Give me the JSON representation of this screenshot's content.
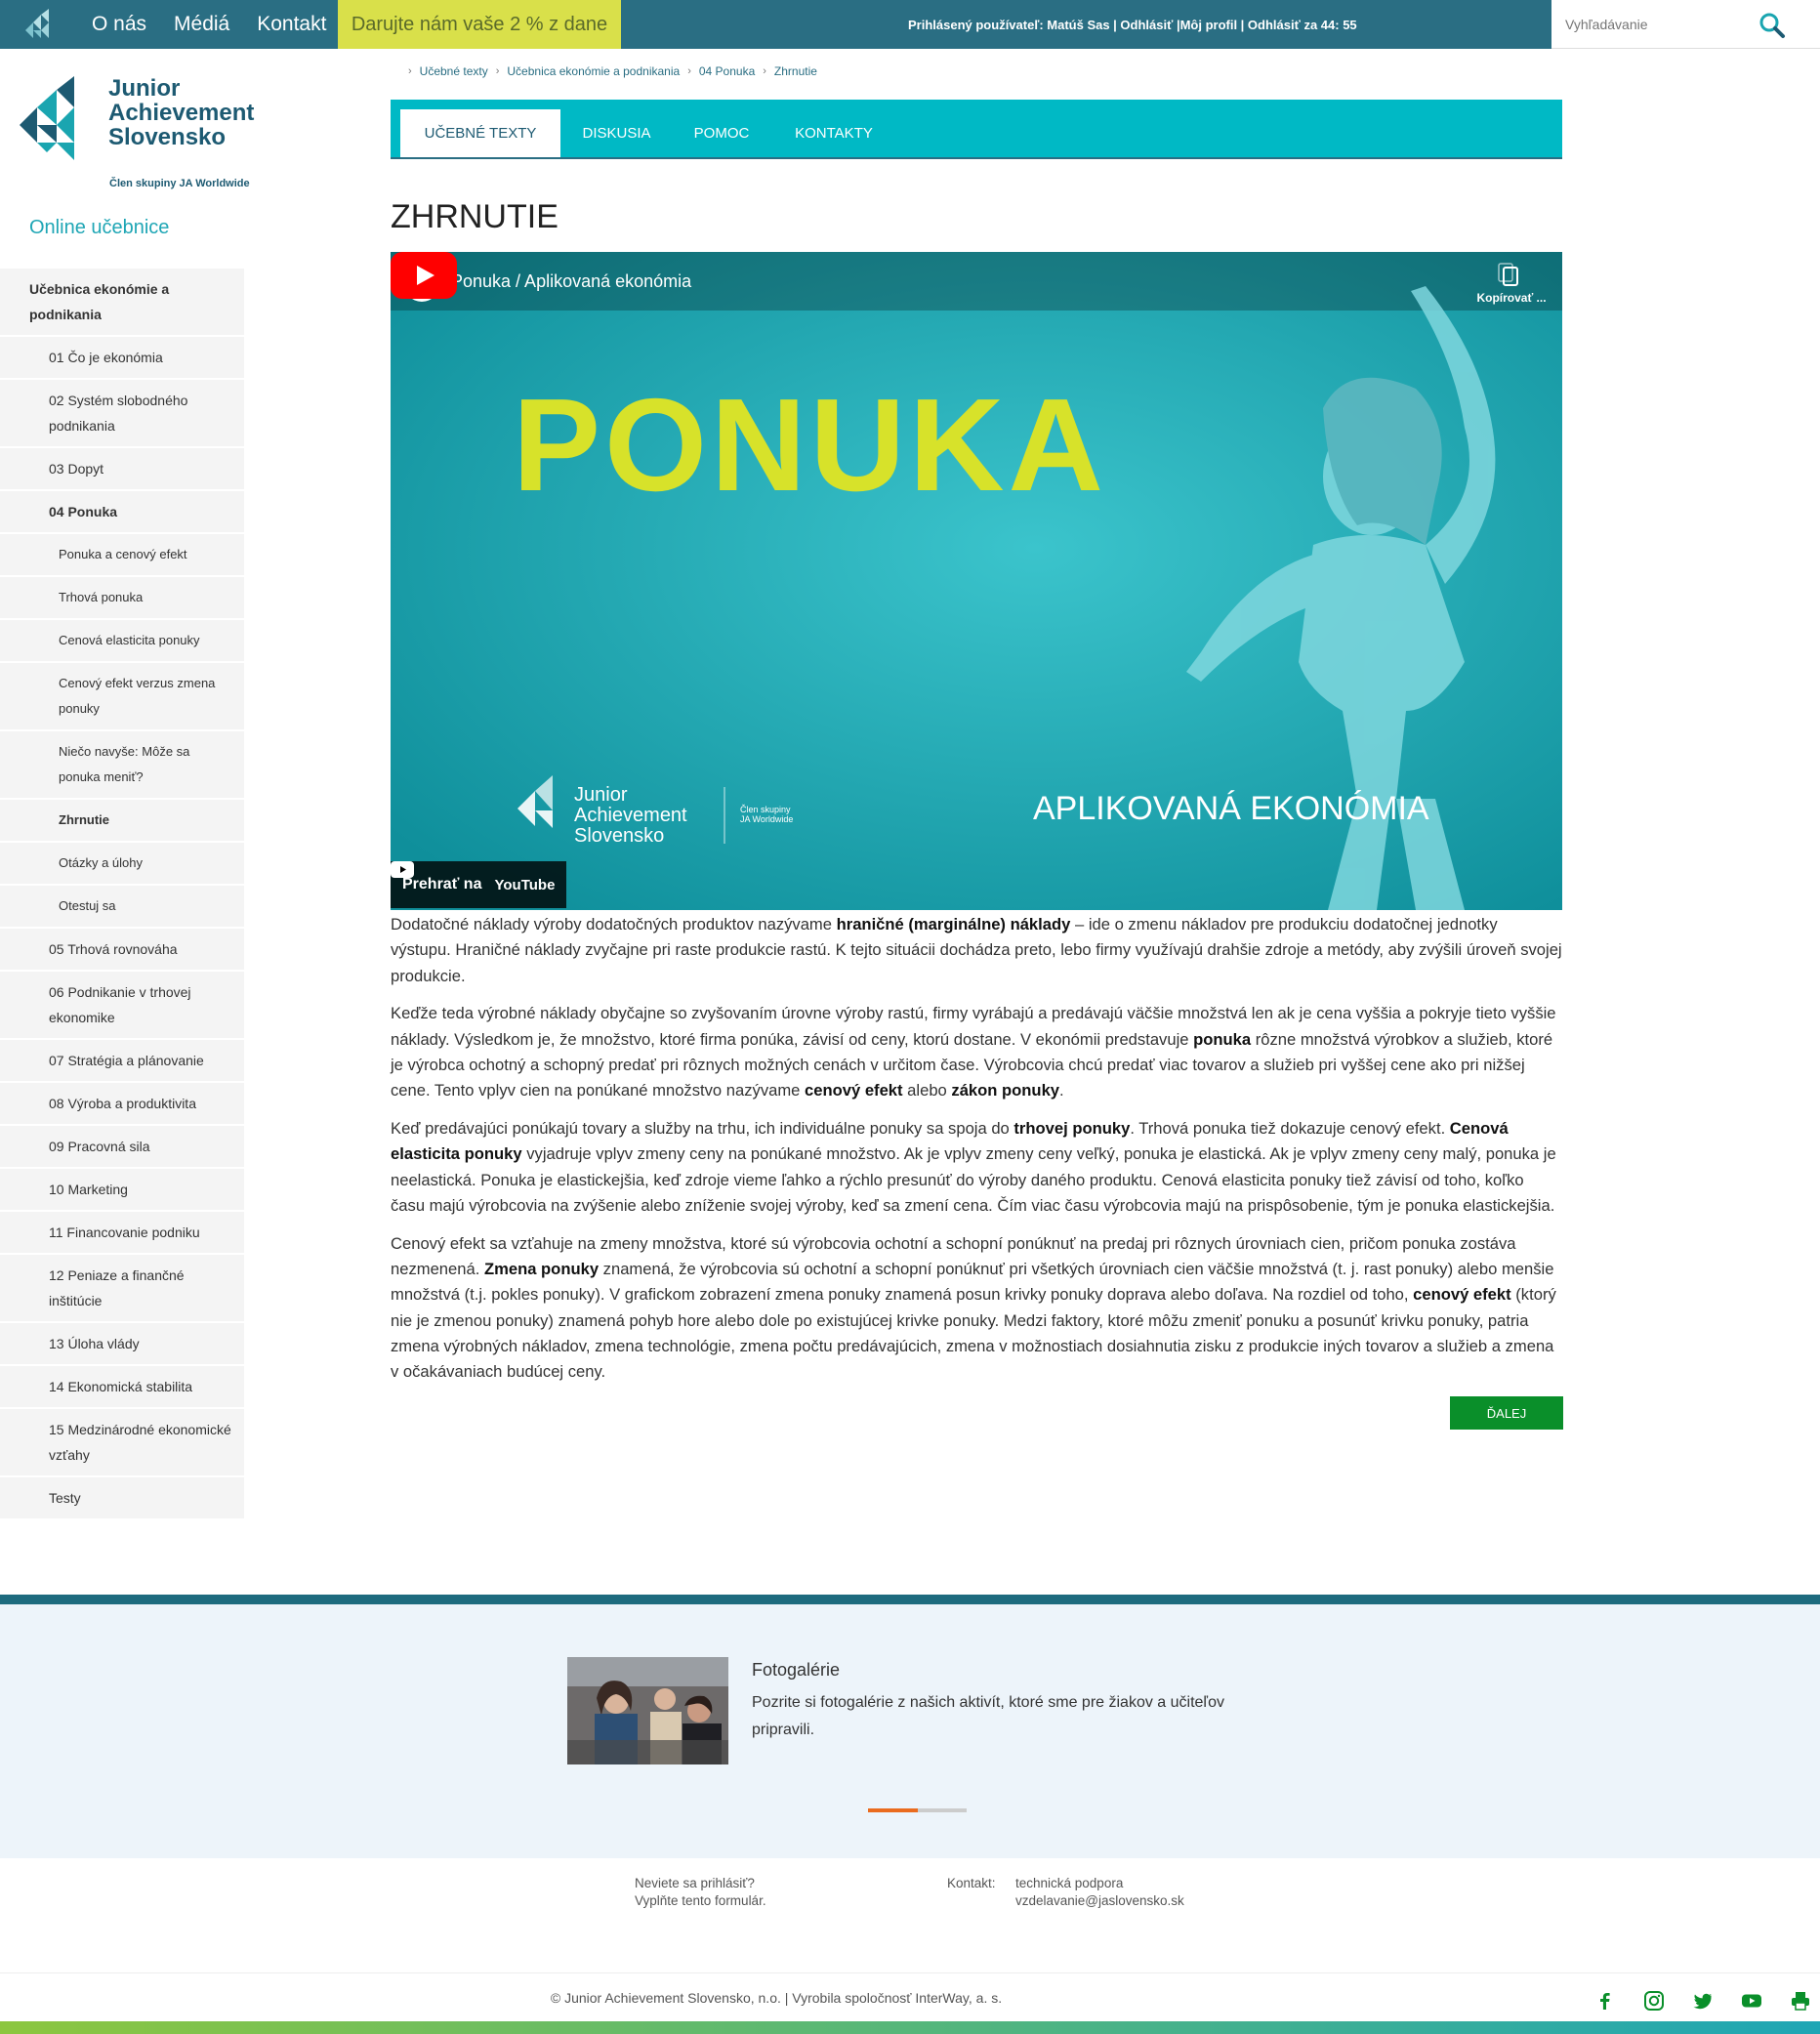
{
  "topbar": {
    "nav": [
      "O nás",
      "Médiá",
      "Kontakt"
    ],
    "donate": "Darujte nám vaše 2 % z dane",
    "user_info": "Prihlásený používateľ: Matúš Sas | Odhlásiť |Môj profil | Odhlásiť za 44: 55",
    "search_placeholder": "Vyhľadávanie"
  },
  "brand": {
    "line1": "Junior",
    "line2": "Achievement",
    "line3": "Slovensko",
    "sub": "Člen skupiny JA Worldwide"
  },
  "sidebar": {
    "heading": "Online učebnice",
    "items": [
      {
        "label": "Učebnica ekonómie a podnikania",
        "level": "top"
      },
      {
        "label": "01 Čo je ekonómia",
        "level": "chapter"
      },
      {
        "label": "02 Systém slobodného podnikania",
        "level": "chapter"
      },
      {
        "label": "03 Dopyt",
        "level": "chapter"
      },
      {
        "label": "04 Ponuka",
        "level": "chapter",
        "active": true
      },
      {
        "label": "Ponuka a cenový efekt",
        "level": "sub"
      },
      {
        "label": "Trhová ponuka",
        "level": "sub"
      },
      {
        "label": "Cenová elasticita ponuky",
        "level": "sub"
      },
      {
        "label": "Cenový efekt verzus zmena ponuky",
        "level": "sub"
      },
      {
        "label": "Niečo navyše: Môže sa ponuka meniť?",
        "level": "sub"
      },
      {
        "label": "Zhrnutie",
        "level": "sub",
        "active": true
      },
      {
        "label": "Otázky a úlohy",
        "level": "sub"
      },
      {
        "label": "Otestuj sa",
        "level": "sub"
      },
      {
        "label": "05 Trhová rovnováha",
        "level": "chapter"
      },
      {
        "label": "06 Podnikanie v trhovej ekonomike",
        "level": "chapter"
      },
      {
        "label": "07 Stratégia a plánovanie",
        "level": "chapter"
      },
      {
        "label": "08 Výroba a produktivita",
        "level": "chapter"
      },
      {
        "label": "09 Pracovná sila",
        "level": "chapter"
      },
      {
        "label": "10 Marketing",
        "level": "chapter"
      },
      {
        "label": "11 Financovanie podniku",
        "level": "chapter"
      },
      {
        "label": "12 Peniaze a finančné inštitúcie",
        "level": "chapter"
      },
      {
        "label": "13 Úloha vlády",
        "level": "chapter"
      },
      {
        "label": "14 Ekonomická stabilita",
        "level": "chapter"
      },
      {
        "label": "15 Medzinárodné ekonomické vzťahy",
        "level": "chapter"
      },
      {
        "label": "Testy",
        "level": "chapter"
      }
    ]
  },
  "breadcrumb": [
    "Učebné texty",
    "Učebnica ekonómie a podnikania",
    "04 Ponuka",
    "Zhrnutie"
  ],
  "tabs": [
    {
      "label": "UČEBNÉ TEXTY",
      "active": true
    },
    {
      "label": "DISKUSIA"
    },
    {
      "label": "POMOC"
    },
    {
      "label": "KONTAKTY"
    }
  ],
  "page_title": "ZHRNUTIE",
  "video": {
    "title": "Ponuka / Aplikovaná ekonómia",
    "copy_label": "Kopírovať ...",
    "big_text": "PONUKA",
    "bottom_text": "APLIKOVANÁ EKONÓMIA",
    "brand_line1": "Junior",
    "brand_line2": "Achievement",
    "brand_line3": "Slovensko",
    "brand_sub1": "Člen skupiny",
    "brand_sub2": "JA Worldwide",
    "watch_on": "Prehrať na",
    "youtube": "YouTube"
  },
  "paragraphs": [
    [
      {
        "t": "Dodatočné náklady výroby dodatočných produktov nazývame "
      },
      {
        "t": "hraničné (marginálne) náklady",
        "b": true
      },
      {
        "t": " – ide o zmenu nákladov pre produkciu dodatočnej jednotky výstupu. Hraničné náklady zvyčajne pri raste produkcie rastú. K tejto situácii dochádza preto, lebo firmy využívajú drahšie zdroje a metódy, aby zvýšili úroveň svojej produkcie."
      }
    ],
    [
      {
        "t": "Keďže teda výrobné náklady obyčajne so zvyšovaním úrovne výroby rastú, firmy vyrábajú a predávajú väčšie množstvá len ak je cena vyššia a pokryje tieto vyššie náklady. Výsledkom je, že množstvo, ktoré firma ponúka, závisí od ceny, ktorú dostane. V ekonómii predstavuje "
      },
      {
        "t": "ponuka",
        "b": true
      },
      {
        "t": " rôzne množstvá výrobkov a služieb, ktoré je výrobca ochotný a schopný predať pri rôznych možných cenách v určitom čase. Výrobcovia chcú predať viac tovarov a služieb pri vyššej cene ako pri nižšej cene. Tento vplyv cien na ponúkané množstvo nazývame "
      },
      {
        "t": "cenový efekt",
        "b": true
      },
      {
        "t": " alebo "
      },
      {
        "t": "zákon ponuky",
        "b": true
      },
      {
        "t": "."
      }
    ],
    [
      {
        "t": "Keď predávajúci ponúkajú tovary a služby na trhu, ich individuálne ponuky sa spoja do "
      },
      {
        "t": "trhovej ponuky",
        "b": true
      },
      {
        "t": ". Trhová ponuka tiež dokazuje cenový efekt. "
      },
      {
        "t": "Cenová elasticita ponuky",
        "b": true
      },
      {
        "t": " vyjadruje vplyv zmeny ceny na ponúkané množstvo. Ak je vplyv zmeny ceny veľký, ponuka je elastická. Ak je vplyv zmeny ceny malý, ponuka je neelastická. Ponuka je elastickejšia, keď zdroje vieme ľahko a rýchlo presunúť do výroby daného produktu. Cenová elasticita ponuky tiež závisí od toho, koľko času majú výrobcovia na zvýšenie alebo zníženie svojej výroby, keď sa zmení cena. Čím viac času výrobcovia majú na prispôsobenie, tým je ponuka elastickejšia."
      }
    ],
    [
      {
        "t": "Cenový efekt sa vzťahuje na zmeny množstva, ktoré sú výrobcovia ochotní a schopní ponúknuť na predaj pri rôznych úrovniach cien, pričom ponuka zostáva nezmenená. "
      },
      {
        "t": "Zmena ponuky",
        "b": true
      },
      {
        "t": " znamená, že výrobcovia sú ochotní a schopní ponúknuť pri všetkých úrovniach cien väčšie množstvá (t. j. rast ponuky) alebo menšie množstvá (t.j. pokles ponuky). V grafickom zobrazení zmena ponuky znamená posun krivky ponuky doprava alebo doľava. Na rozdiel od toho, "
      },
      {
        "t": "cenový efekt",
        "b": true
      },
      {
        "t": " (ktorý nie je zmenou ponuky) znamená pohyb hore alebo dole po existujúcej krivke ponuky. Medzi faktory, ktoré môžu zmeniť ponuku a posunúť krivku ponuky, patria zmena výrobných nákladov, zmena technológie, zmena počtu predávajúcich, zmena v možnostiach dosiahnutia zisku z produkcie iných tovarov a služieb a zmena v očakávaniach budúcej ceny."
      }
    ]
  ],
  "next_button": "ĎALEJ",
  "gallery": {
    "title": "Fotogalérie",
    "text": "Pozrite si fotogalérie z našich aktivít, ktoré sme pre žiakov a učiteľov pripravili.",
    "progress": 0.5
  },
  "footer": {
    "help_line1": "Neviete sa prihlásiť?",
    "help_line2": "Vyplňte tento formulár.",
    "contact_label": "Kontakt:",
    "contact_line1": "technická podpora",
    "contact_line2": "vzdelavanie@jaslovensko.sk",
    "copyright": "© Junior Achievement Slovensko, n.o. | Vyrobila spoločnosť InterWay, a. s.",
    "social": [
      "facebook-icon",
      "instagram-icon",
      "twitter-icon",
      "youtube-icon",
      "print-icon"
    ]
  },
  "colors": {
    "topbar": "#2a6e83",
    "teal": "#00b9c5",
    "donate": "#d9e04a",
    "next": "#0a8f2a",
    "video_bg": "#1aa5b0",
    "video_text": "#d7e22a"
  }
}
